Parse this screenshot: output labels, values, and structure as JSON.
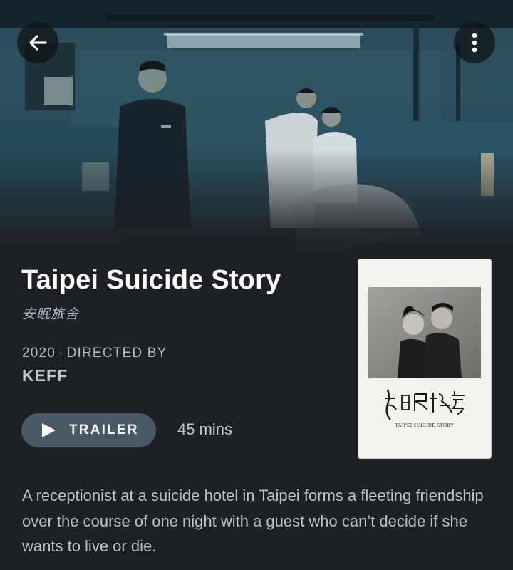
{
  "header": {
    "back_icon": "arrow-left-icon",
    "more_icon": "more-vertical-icon"
  },
  "movie": {
    "title": "Taipei Suicide Story",
    "original_title": "安眠旅舍",
    "year": "2020",
    "directed_by_label": "DIRECTED BY",
    "director": "KEFF",
    "trailer_label": "TRAILER",
    "runtime": "45 mins",
    "synopsis": "A receptionist at a suicide hotel in Taipei forms a fleeting friendship over the course of one night with a guest who can’t decide if she wants to live or die."
  },
  "poster": {
    "title_calligraphy": "安眠旅舍",
    "caption": "TAIPEI SUICIDE STORY"
  },
  "colors": {
    "background": "#1d2024",
    "button": "#4a5866",
    "muted_text": "#b6bcc4"
  }
}
